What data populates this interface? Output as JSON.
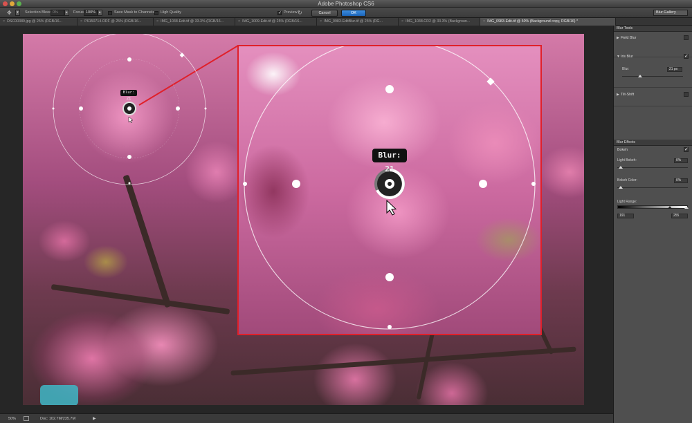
{
  "window": {
    "title": "Adobe Photoshop CS6"
  },
  "options_bar": {
    "selection_bleed_label": "Selection Bleed:",
    "selection_bleed_value": "0%",
    "focus_label": "Focus:",
    "focus_value": "100%",
    "save_mask_label": "Save Mask to Channels",
    "high_quality_label": "High Quality",
    "preview_label": "Preview",
    "cancel_label": "Cancel",
    "ok_label": "OK",
    "workspace_label": "Blur Gallery"
  },
  "tabs": [
    {
      "label": "DSC00389.jpg @ 25% (RGB/16..."
    },
    {
      "label": "P6150714.ORF @ 25% (RGB/16..."
    },
    {
      "label": "IMG_1038-Edit.tif @ 33.3% (RGB/16..."
    },
    {
      "label": "IMG_1009-Edit.tif @ 25% (RGB/16..."
    },
    {
      "label": "IMG_0983-EditBlur.tif @ 25% (RG..."
    },
    {
      "label": "IMG_1038.CR2 @ 33.3% (Backgroun..."
    },
    {
      "label": "IMG_0983-Edit.tif @ 50% (Background copy, RGB/16) *"
    }
  ],
  "canvas": {
    "blur_label_small": "Blur: 21",
    "blur_label_large": "Blur: 21"
  },
  "status_bar": {
    "zoom": "50%",
    "doc_size": "Doc: 102.7M/235.7M"
  },
  "panel": {
    "blur_tools_header": "Blur Tools",
    "field_blur_label": "Field Blur",
    "iris_blur_label": "Iris Blur",
    "blur_label": "Blur:",
    "blur_value": "21 px",
    "blur_fraction": 0.3,
    "tilt_shift_label": "Tilt-Shift",
    "blur_effects_header": "Blur Effects",
    "bokeh_label": "Bokeh",
    "light_bokeh_label": "Light Bokeh:",
    "light_bokeh_value": "0%",
    "bokeh_color_label": "Bokeh Color:",
    "bokeh_color_value": "0%",
    "light_range_label": "Light Range:",
    "light_range_min": "191",
    "light_range_max": "255"
  },
  "colors": {
    "inset_border": "#e0202a",
    "ok_button": "#1c64b8"
  }
}
